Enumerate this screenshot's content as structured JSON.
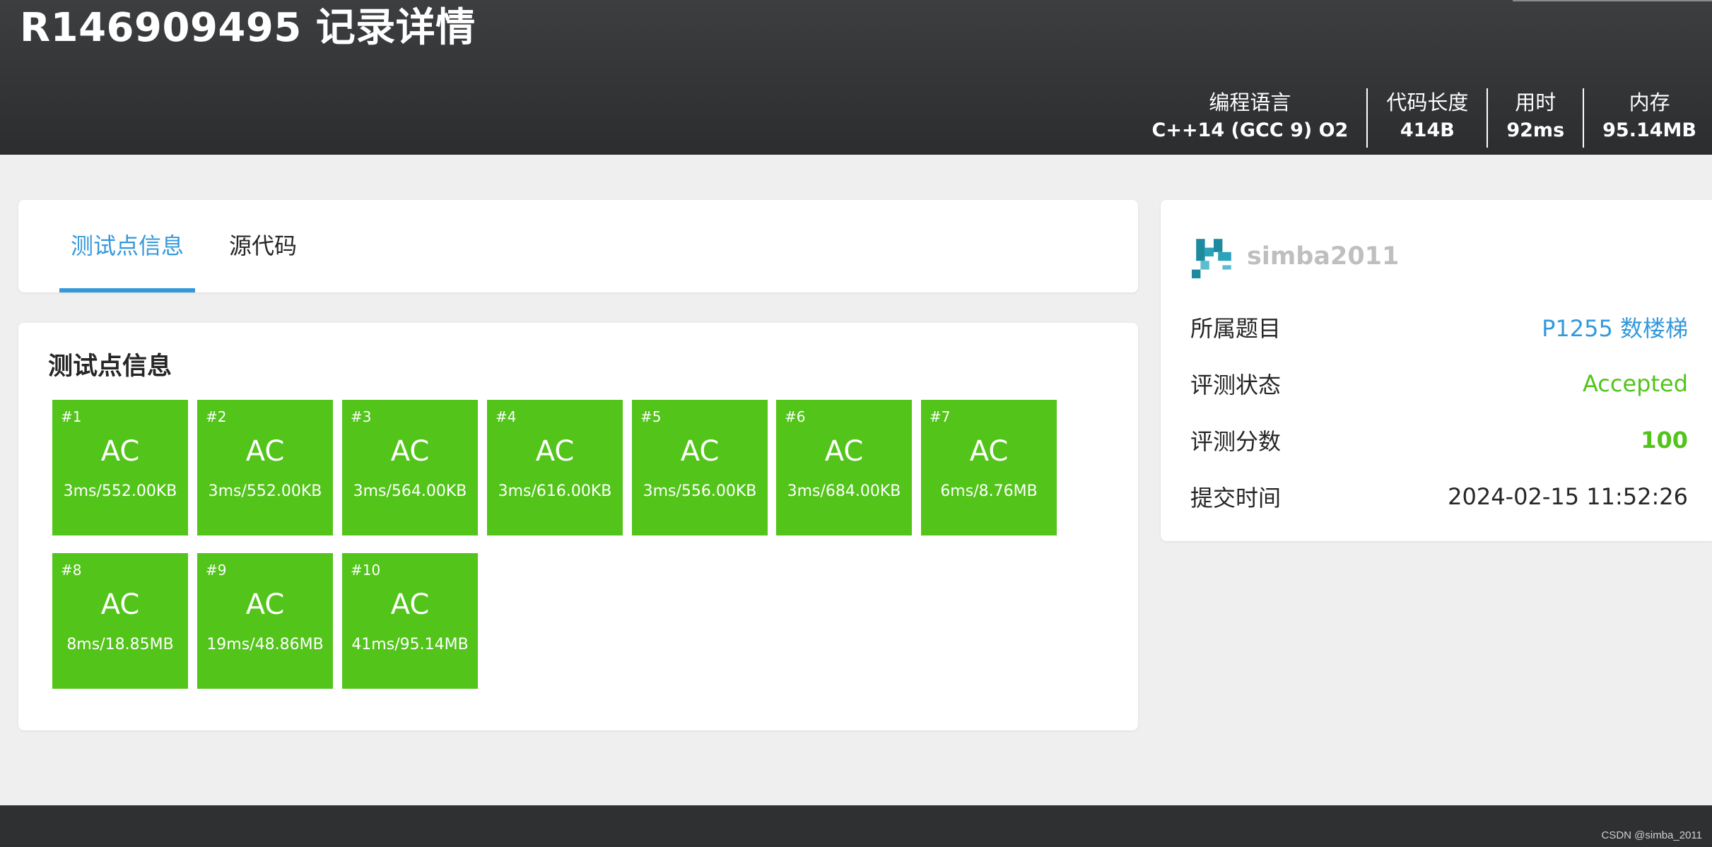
{
  "header": {
    "title": "R146909495 记录详情",
    "stats": [
      {
        "label": "编程语言",
        "value": "C++14 (GCC 9) O2"
      },
      {
        "label": "代码长度",
        "value": "414B"
      },
      {
        "label": "用时",
        "value": "92ms"
      },
      {
        "label": "内存",
        "value": "95.14MB"
      }
    ]
  },
  "tabs": [
    {
      "label": "测试点信息",
      "active": true
    },
    {
      "label": "源代码",
      "active": false
    }
  ],
  "testcases": {
    "title": "测试点信息",
    "color": "#52c41a",
    "items": [
      {
        "num": "#1",
        "status": "AC",
        "detail": "3ms/552.00KB"
      },
      {
        "num": "#2",
        "status": "AC",
        "detail": "3ms/552.00KB"
      },
      {
        "num": "#3",
        "status": "AC",
        "detail": "3ms/564.00KB"
      },
      {
        "num": "#4",
        "status": "AC",
        "detail": "3ms/616.00KB"
      },
      {
        "num": "#5",
        "status": "AC",
        "detail": "3ms/556.00KB"
      },
      {
        "num": "#6",
        "status": "AC",
        "detail": "3ms/684.00KB"
      },
      {
        "num": "#7",
        "status": "AC",
        "detail": "6ms/8.76MB"
      },
      {
        "num": "#8",
        "status": "AC",
        "detail": "8ms/18.85MB"
      },
      {
        "num": "#9",
        "status": "AC",
        "detail": "19ms/48.86MB"
      },
      {
        "num": "#10",
        "status": "AC",
        "detail": "41ms/95.14MB"
      }
    ]
  },
  "sidebar": {
    "username": "simba2011",
    "rows": [
      {
        "key": "所属题目",
        "value": "P1255 数楼梯"
      },
      {
        "key": "评测状态",
        "value": "Accepted"
      },
      {
        "key": "评测分数",
        "value": "100"
      },
      {
        "key": "提交时间",
        "value": "2024-02-15 11:52:26"
      }
    ]
  },
  "watermark": "CSDN @simba_2011",
  "colors": {
    "accent": "#3498db",
    "success": "#52c41a",
    "header": "#2c2d2f"
  }
}
